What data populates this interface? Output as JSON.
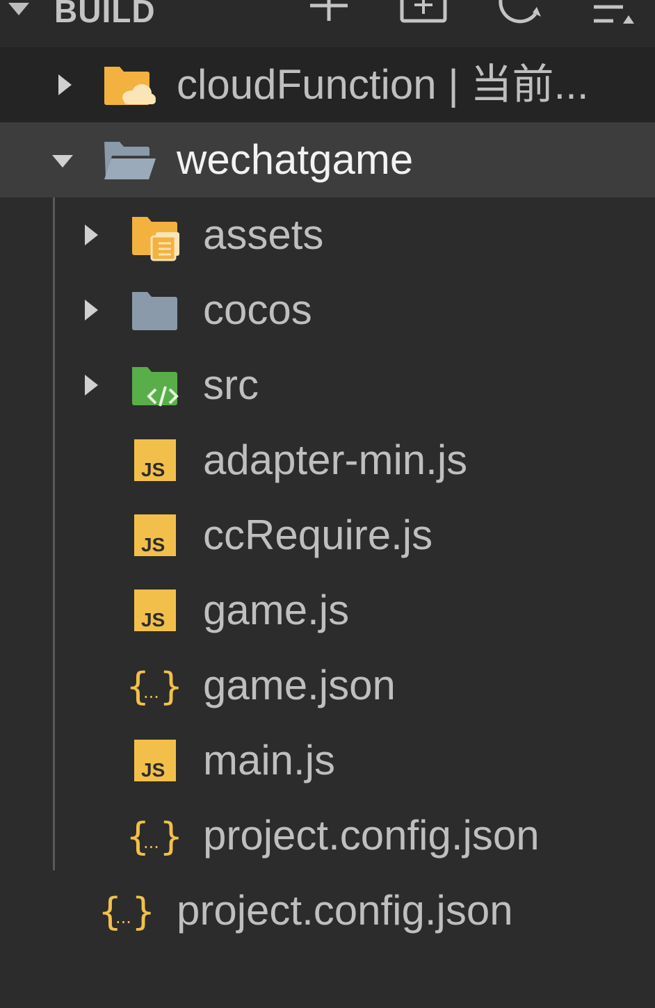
{
  "header": {
    "title": "BUILD",
    "actions": [
      {
        "name": "new-file-button",
        "icon": "plus-icon"
      },
      {
        "name": "new-folder-button",
        "icon": "add-box-icon"
      },
      {
        "name": "refresh-button",
        "icon": "refresh-icon"
      },
      {
        "name": "collapse-all-button",
        "icon": "sort-icon"
      }
    ]
  },
  "tree": {
    "cloudfunction": {
      "label": "cloudFunction | 当前...",
      "icon": "cloud-folder-icon",
      "expanded": false
    },
    "wechatgame": {
      "label": "wechatgame",
      "icon": "folder-open-icon",
      "expanded": true,
      "selected": true
    },
    "children": [
      {
        "label": "assets",
        "icon": "assets-folder-icon",
        "type": "folder"
      },
      {
        "label": "cocos",
        "icon": "folder-icon",
        "type": "folder"
      },
      {
        "label": "src",
        "icon": "src-folder-icon",
        "type": "folder"
      },
      {
        "label": "adapter-min.js",
        "icon": "js-file-icon",
        "type": "file"
      },
      {
        "label": "ccRequire.js",
        "icon": "js-file-icon",
        "type": "file"
      },
      {
        "label": "game.js",
        "icon": "js-file-icon",
        "type": "file"
      },
      {
        "label": "game.json",
        "icon": "json-file-icon",
        "type": "file"
      },
      {
        "label": "main.js",
        "icon": "js-file-icon",
        "type": "file"
      },
      {
        "label": "project.config.json",
        "icon": "json-file-icon",
        "type": "file"
      }
    ],
    "root_file": {
      "label": "project.config.json",
      "icon": "json-file-icon"
    }
  },
  "colors": {
    "background": "#2c2c2c",
    "selected_row": "#3d3d3d",
    "js_yellow": "#f2c04a",
    "folder_orange": "#f3b13f",
    "folder_gray": "#8a9aab",
    "folder_green": "#5aae4a",
    "text": "#bfbfbf"
  }
}
